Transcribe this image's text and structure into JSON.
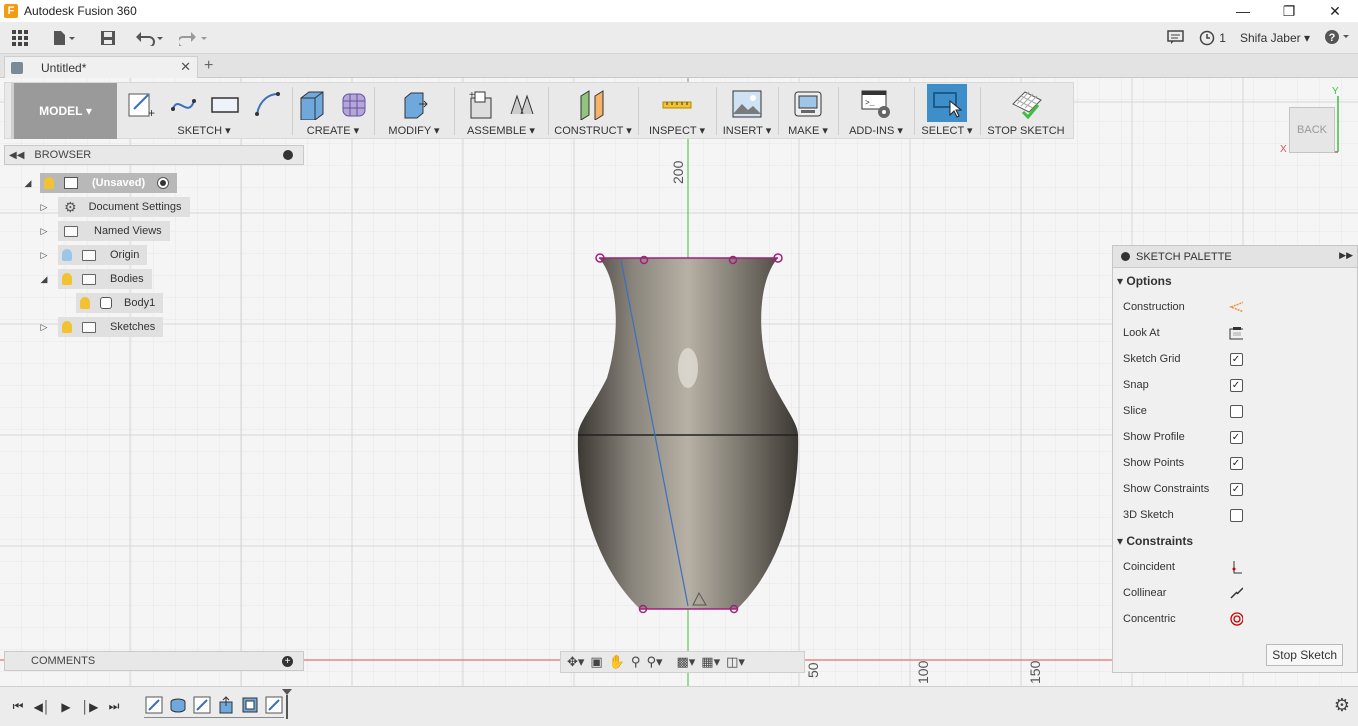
{
  "window": {
    "title": "Autodesk Fusion 360",
    "app_icon": "F"
  },
  "quick_access": {
    "jobs_count": "1",
    "user_name": "Shifa Jaber"
  },
  "document_tab": {
    "label": "Untitled*"
  },
  "ribbon": {
    "workspace": "MODEL",
    "groups": [
      {
        "label": "SKETCH"
      },
      {
        "label": "CREATE"
      },
      {
        "label": "MODIFY"
      },
      {
        "label": "ASSEMBLE"
      },
      {
        "label": "CONSTRUCT"
      },
      {
        "label": "INSPECT"
      },
      {
        "label": "INSERT"
      },
      {
        "label": "MAKE"
      },
      {
        "label": "ADD-INS"
      },
      {
        "label": "SELECT"
      },
      {
        "label": "STOP SKETCH"
      }
    ]
  },
  "viewcube": {
    "face": "BACK",
    "axis_y": "Y",
    "axis_x": "X"
  },
  "browser": {
    "title": "BROWSER",
    "root": "(Unsaved)",
    "items": [
      {
        "label": "Document Settings"
      },
      {
        "label": "Named Views"
      },
      {
        "label": "Origin"
      },
      {
        "label": "Bodies"
      },
      {
        "label": "Body1"
      },
      {
        "label": "Sketches"
      }
    ]
  },
  "comments": {
    "title": "COMMENTS"
  },
  "grid_labels": {
    "vertical_200": "200",
    "h_50a": "50",
    "h_100": "100",
    "h_150": "150"
  },
  "palette": {
    "title": "SKETCH PALETTE",
    "options_title": "Options",
    "options": [
      {
        "label": "Construction",
        "type": "icon"
      },
      {
        "label": "Look At",
        "type": "icon"
      },
      {
        "label": "Sketch Grid",
        "type": "checkbox",
        "checked": true
      },
      {
        "label": "Snap",
        "type": "checkbox",
        "checked": true
      },
      {
        "label": "Slice",
        "type": "checkbox",
        "checked": false
      },
      {
        "label": "Show Profile",
        "type": "checkbox",
        "checked": true
      },
      {
        "label": "Show Points",
        "type": "checkbox",
        "checked": true
      },
      {
        "label": "Show Constraints",
        "type": "checkbox",
        "checked": true
      },
      {
        "label": "3D Sketch",
        "type": "checkbox",
        "checked": false
      }
    ],
    "constraints_title": "Constraints",
    "constraints": [
      {
        "label": "Coincident"
      },
      {
        "label": "Collinear"
      },
      {
        "label": "Concentric"
      }
    ],
    "stop_button": "Stop Sketch"
  },
  "colors": {
    "select_active": "#3d8ec9",
    "sketch_point": "#a0207a",
    "axis_green": "#3cbf3c",
    "axis_red": "#e05050"
  }
}
